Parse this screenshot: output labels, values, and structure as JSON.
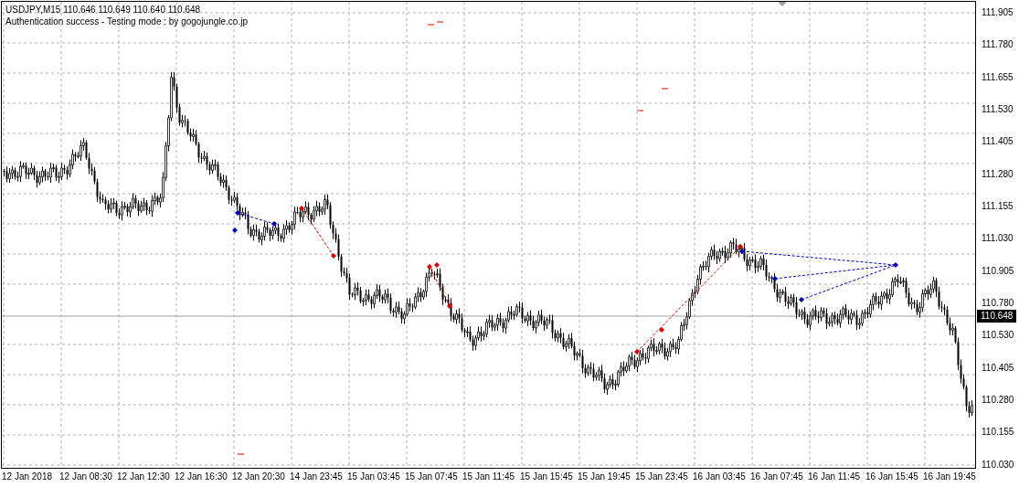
{
  "header": {
    "symbol_line": "USDJPY,M15  110.646 110.649 110.640 110.648",
    "message": "Authentication success - Testing mode : by gogojungle.co.jp"
  },
  "price_axis": {
    "labels": [
      "111.905",
      "111.780",
      "111.655",
      "111.530",
      "111.405",
      "111.280",
      "111.155",
      "111.030",
      "110.905",
      "110.780",
      "110.530",
      "110.405",
      "110.280",
      "110.155",
      "110.030"
    ],
    "current_price": "110.648"
  },
  "time_axis": {
    "labels": [
      "12 Jan 2018",
      "12 Jan 08:30",
      "12 Jan 12:30",
      "12 Jan 16:30",
      "12 Jan 20:30",
      "14 Jan 23:45",
      "15 Jan 03:45",
      "15 Jan 07:45",
      "15 Jan 11:45",
      "15 Jan 15:45",
      "15 Jan 19:45",
      "15 Jan 23:45",
      "16 Jan 03:45",
      "16 Jan 07:45",
      "16 Jan 11:45",
      "16 Jan 15:45",
      "16 Jan 19:45"
    ]
  }
}
